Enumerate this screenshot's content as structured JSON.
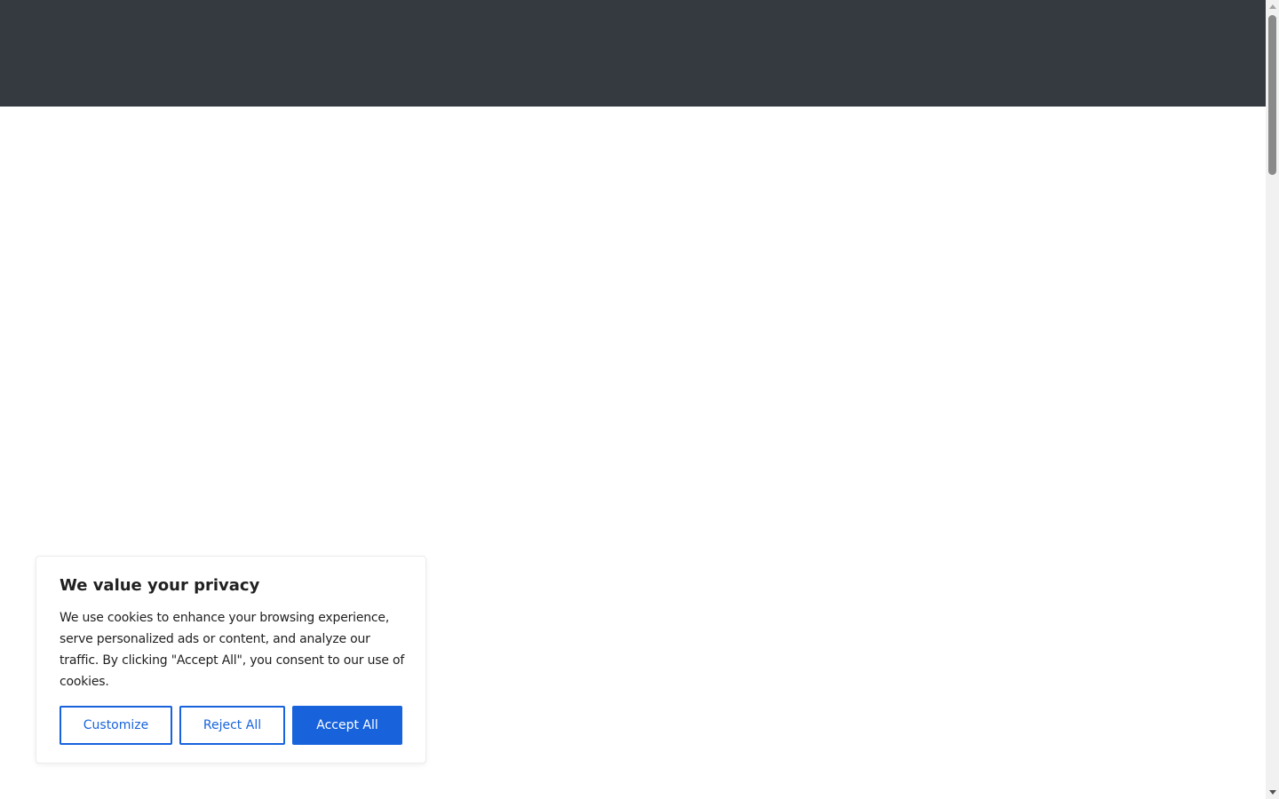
{
  "colors": {
    "header_bg": "#343a40",
    "page_bg": "#ffffff",
    "accent": "#1863dc",
    "text": "#212121"
  },
  "cookie_banner": {
    "title": "We value your privacy",
    "message": "We use cookies to enhance your browsing experience, serve personalized ads or content, and analyze our traffic. By clicking \"Accept All\", you consent to our use of cookies.",
    "buttons": {
      "customize": "Customize",
      "reject": "Reject All",
      "accept": "Accept All"
    }
  },
  "scrollbar": {
    "up_icon": "scroll-up-arrow",
    "down_icon": "scroll-down-arrow"
  }
}
